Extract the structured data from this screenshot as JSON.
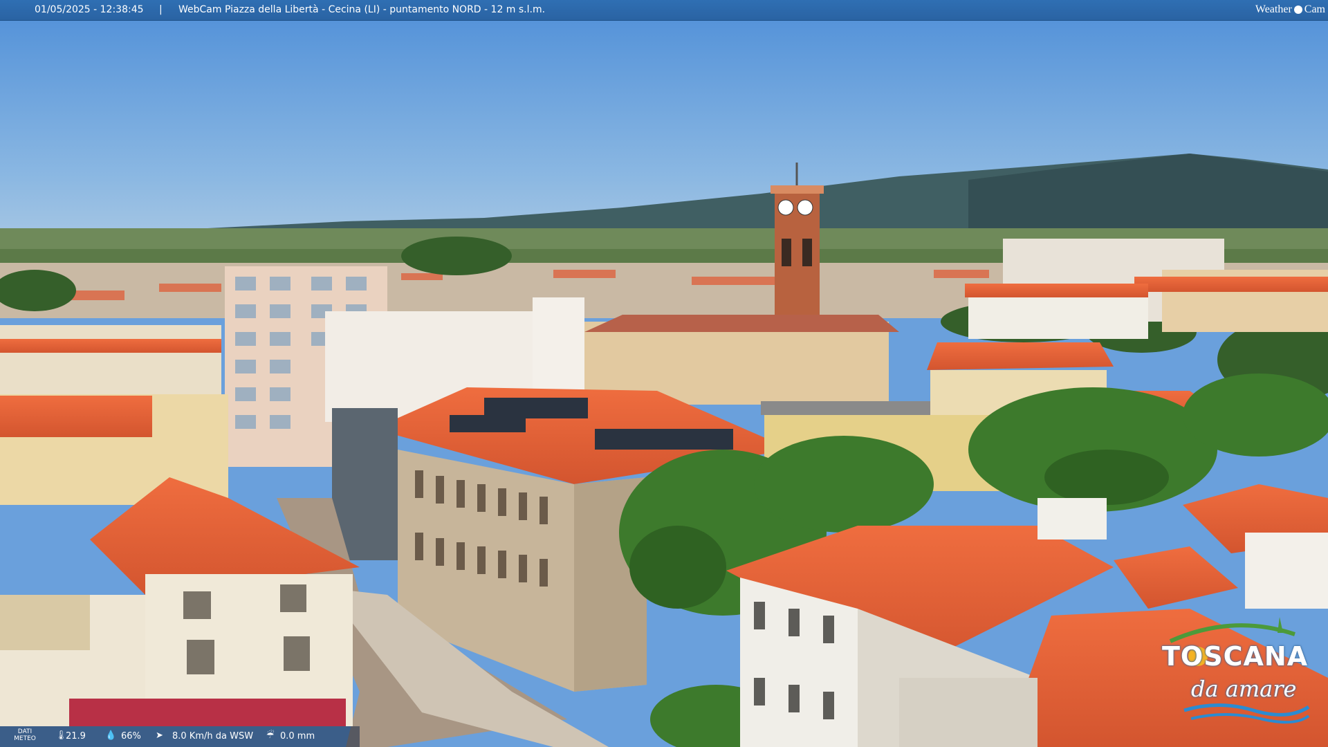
{
  "overlay": {
    "timestamp": "01/05/2025 - 12:38:45",
    "separator": "|",
    "title": "WebCam Piazza della Libertà - Cecina (LI) - puntamento NORD - 12 m s.l.m.",
    "brand_left": "Weather",
    "brand_right": "Cam"
  },
  "weather": {
    "label_line1": "DATI",
    "label_line2": "METEO",
    "temperature": "21.9",
    "humidity": "66%",
    "wind": "8.0 Km/h da WSW",
    "rain": "0.0 mm",
    "icons": [
      "thermometer-icon",
      "humidity-icon",
      "wind-icon",
      "rain-icon"
    ]
  },
  "sponsor": {
    "line1": "TOSCANA",
    "line2": "da amare"
  },
  "colors": {
    "sky": "#6aa0dc",
    "roof": "#e2623a",
    "bar": "#2f6fb3",
    "tree": "#3f7a2f",
    "hills": "#3e5a5c"
  }
}
